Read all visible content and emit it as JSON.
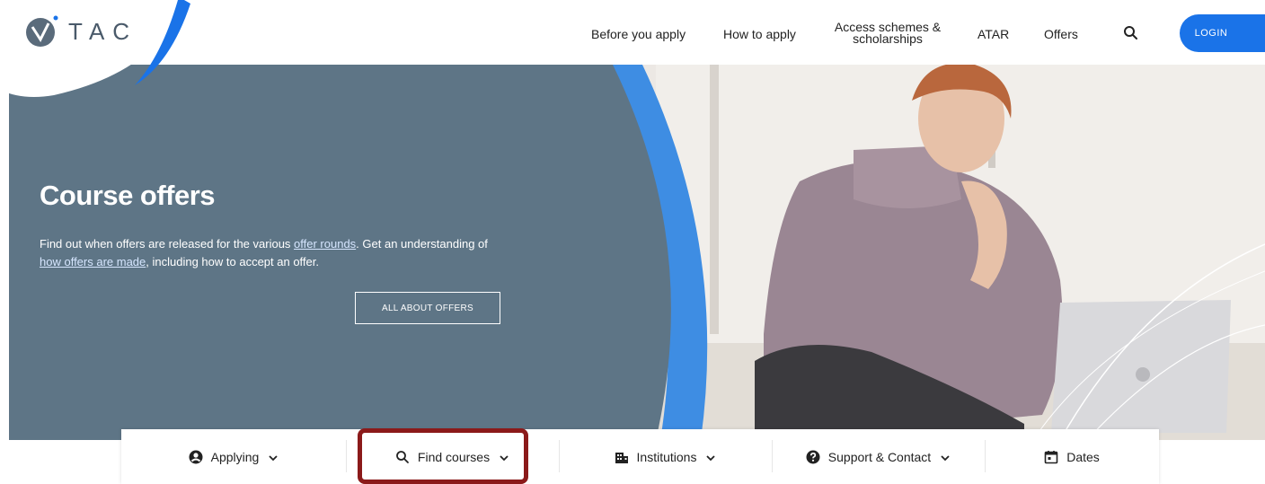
{
  "brand": {
    "logo_text": "TAC"
  },
  "nav": {
    "items": [
      {
        "label": "Before you apply"
      },
      {
        "label": "How to apply"
      },
      {
        "label": "Access schemes & scholarships"
      },
      {
        "label": "ATAR"
      },
      {
        "label": "Offers"
      }
    ],
    "login_label": "LOGIN",
    "search_icon": "search-icon"
  },
  "hero": {
    "title": "Course offers",
    "desc_part1": "Find out when offers are released for the various ",
    "link_offer_rounds": "offer rounds",
    "desc_part2": ". Get an understanding of ",
    "link_how_offers": "how offers are made",
    "desc_part3": ", including how to accept an offer.",
    "button_label": "ALL ABOUT OFFERS"
  },
  "menu": {
    "items": [
      {
        "label": "Applying",
        "icon": "user-circle-icon"
      },
      {
        "label": "Find courses",
        "icon": "search-icon"
      },
      {
        "label": "Institutions",
        "icon": "building-icon"
      },
      {
        "label": "Support & Contact",
        "icon": "question-circle-icon"
      },
      {
        "label": "Dates",
        "icon": "calendar-icon"
      }
    ]
  },
  "colors": {
    "hero_panel": "#5e7586",
    "accent_blue": "#1a73e8",
    "highlight": "#8b1a1a"
  }
}
